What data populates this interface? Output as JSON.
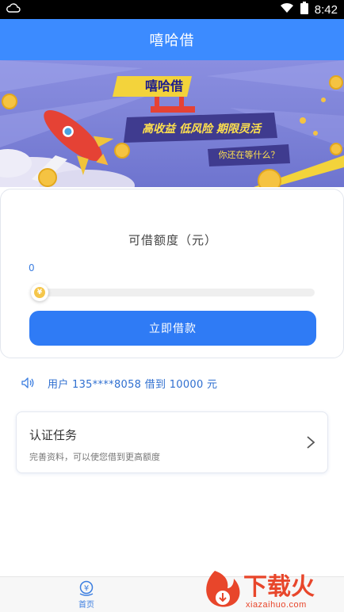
{
  "status_bar": {
    "time": "8:42"
  },
  "header": {
    "title": "嘻哈借"
  },
  "banner": {
    "brand": "嘻哈借",
    "slogan": "高收益 低风险 期限灵活",
    "question": "你还在等什么？"
  },
  "loan": {
    "label": "可借额度（元）",
    "amount": "0",
    "slider_fraction": 0,
    "thumb_symbol": "¥",
    "button_label": "立即借款"
  },
  "notice": {
    "text": "用户 135****8058 借到 10000 元"
  },
  "task": {
    "title": "认证任务",
    "subtitle": "完善资料，可以使您借到更高额度"
  },
  "nav": {
    "home_label": "首页"
  },
  "watermark": {
    "brand": "下载火",
    "domain": "xiazaihuo.com"
  },
  "colors": {
    "primary": "#3c8bff",
    "button": "#2f7bf5",
    "notice_text": "#2f6fd0",
    "watermark": "#e8462b"
  }
}
